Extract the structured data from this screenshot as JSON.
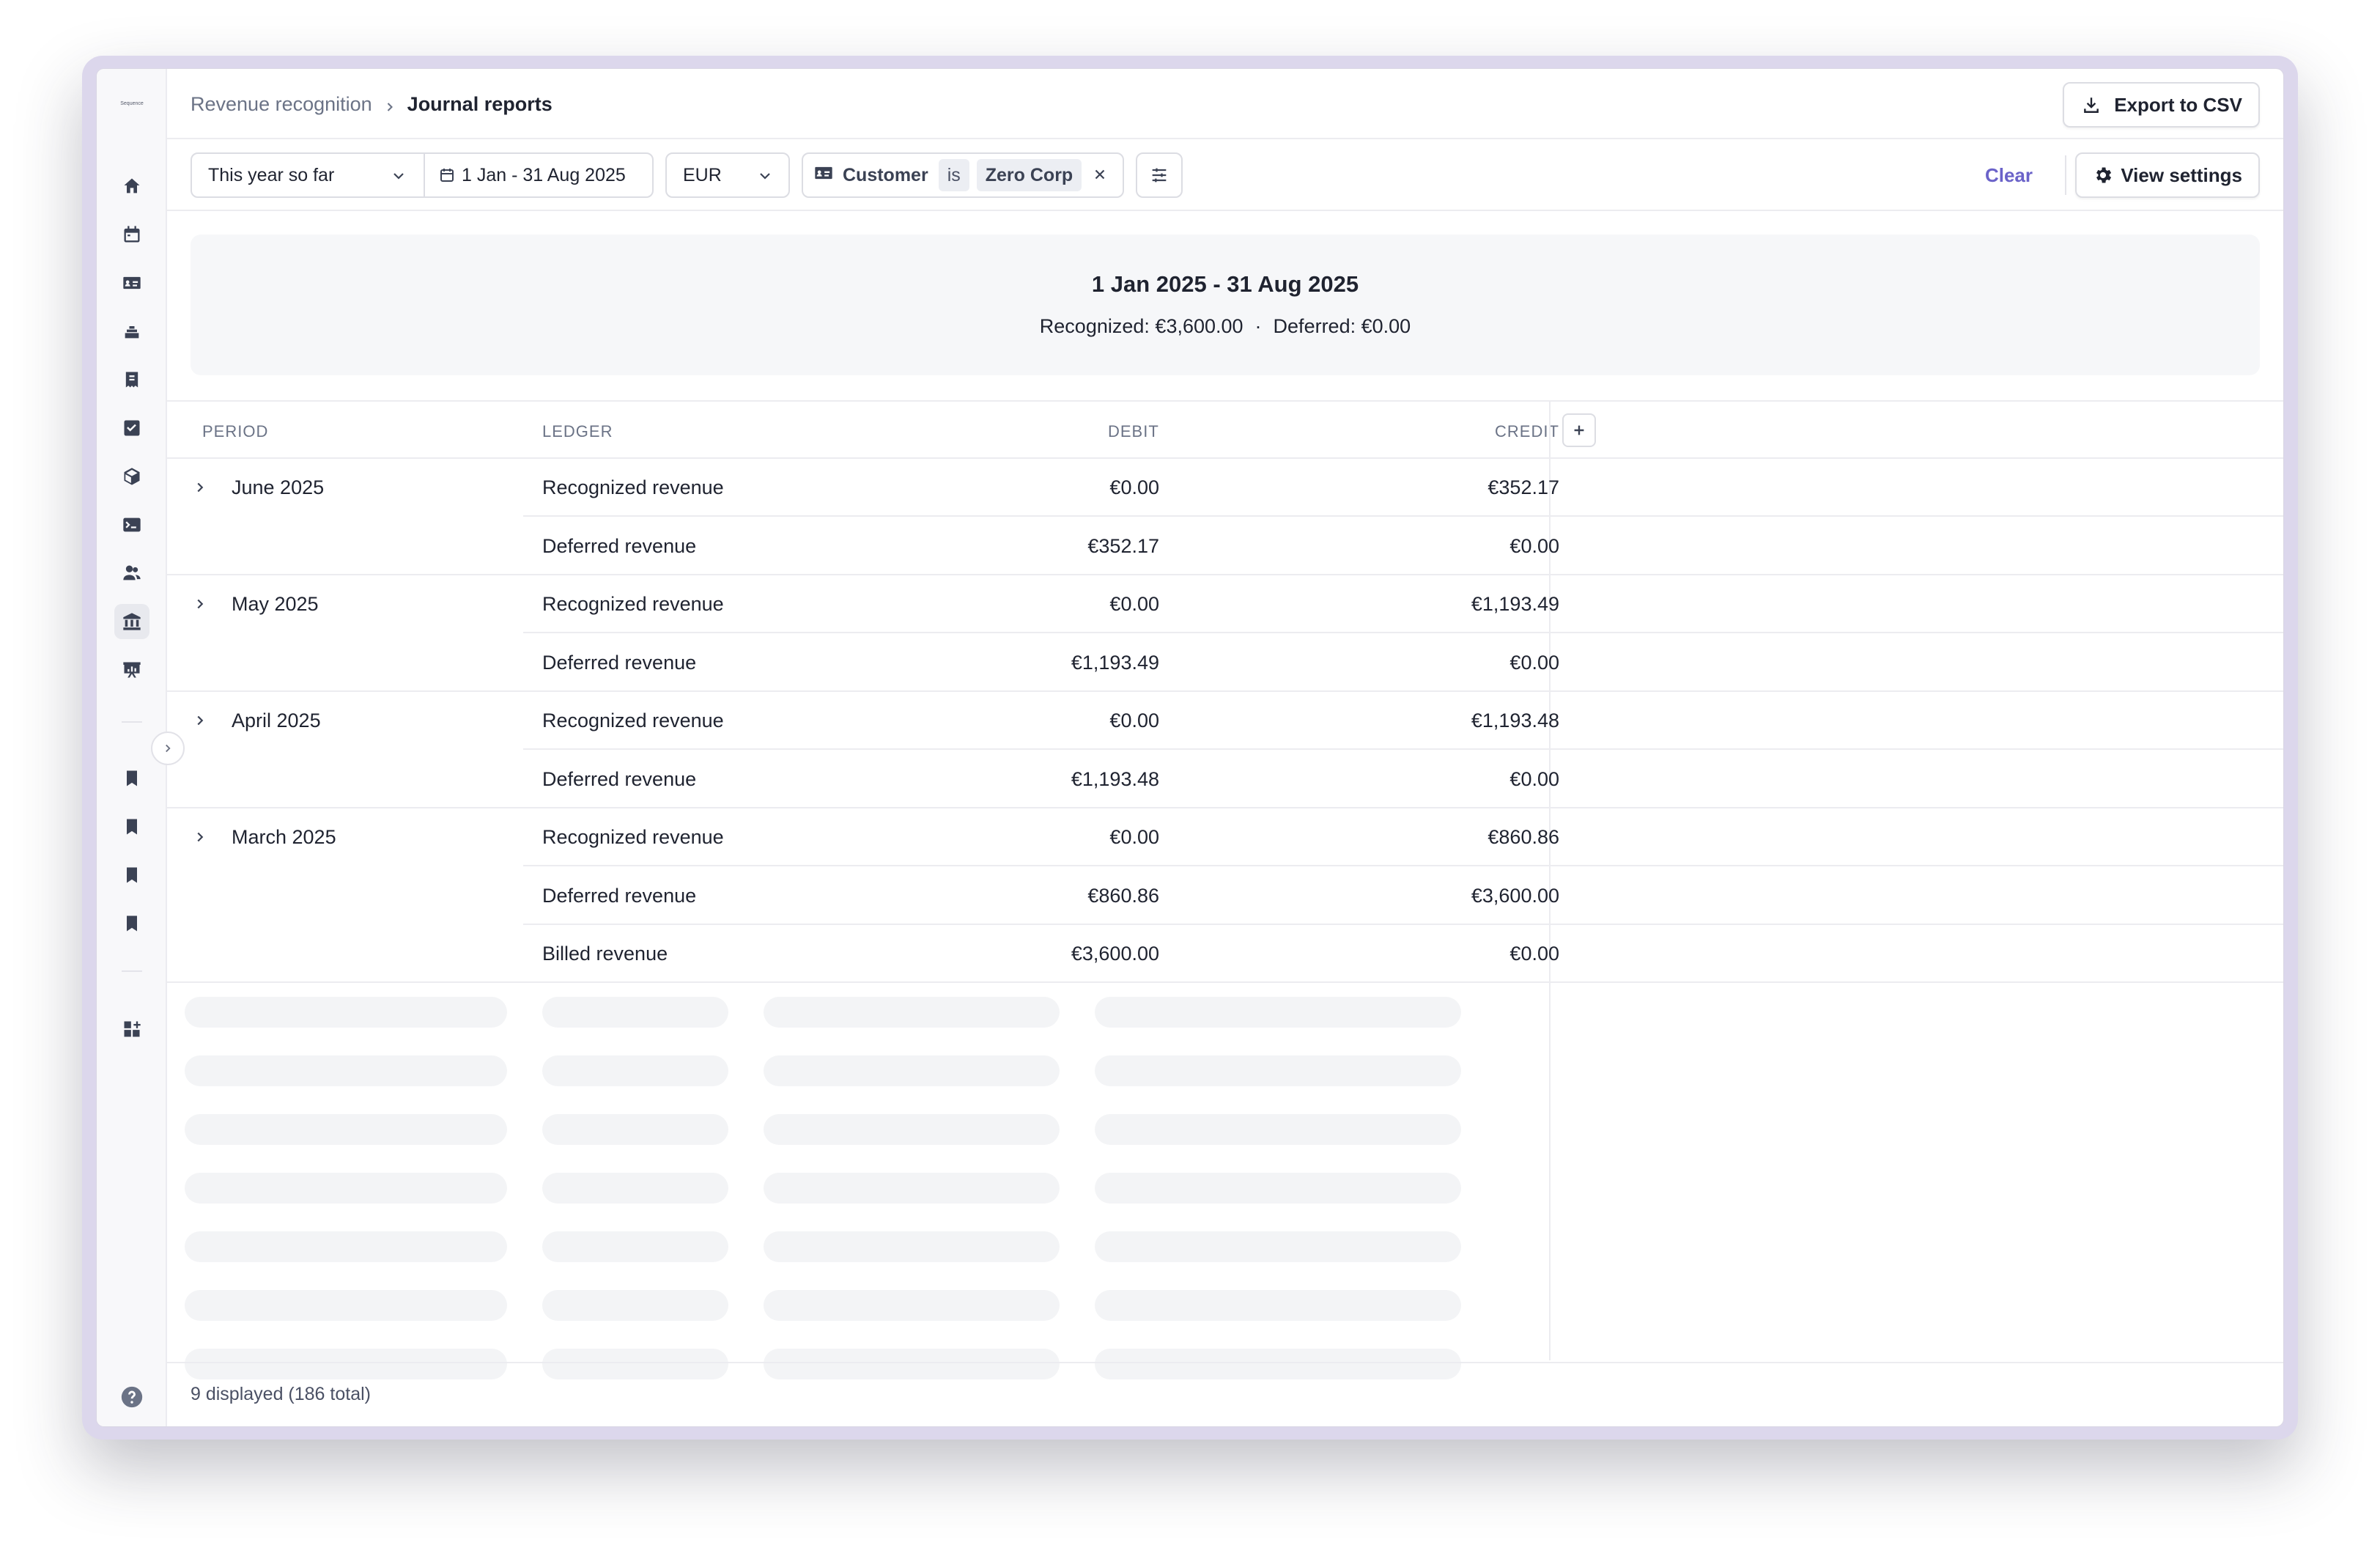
{
  "app": {
    "logo_text": "Sequence"
  },
  "breadcrumb": {
    "parent": "Revenue recognition",
    "current": "Journal reports"
  },
  "header": {
    "export_label": "Export to CSV"
  },
  "filters": {
    "period": "This year so far",
    "date_range": "1 Jan - 31 Aug 2025",
    "currency": "EUR",
    "customer_label": "Customer",
    "customer_operator": "is",
    "customer_value": "Zero Corp",
    "clear_label": "Clear",
    "view_settings_label": "View settings"
  },
  "summary": {
    "title": "1 Jan 2025 - 31 Aug 2025",
    "recognized_label": "Recognized:",
    "recognized_value": "€3,600.00",
    "separator": "·",
    "deferred_label": "Deferred:",
    "deferred_value": "€0.00"
  },
  "table": {
    "columns": {
      "period": "Period",
      "ledger": "Ledger",
      "debit": "Debit",
      "credit": "Credit"
    },
    "groups": [
      {
        "period": "June 2025",
        "rows": [
          {
            "ledger": "Recognized revenue",
            "debit": "€0.00",
            "credit": "€352.17"
          },
          {
            "ledger": "Deferred revenue",
            "debit": "€352.17",
            "credit": "€0.00"
          }
        ]
      },
      {
        "period": "May 2025",
        "rows": [
          {
            "ledger": "Recognized revenue",
            "debit": "€0.00",
            "credit": "€1,193.49"
          },
          {
            "ledger": "Deferred revenue",
            "debit": "€1,193.49",
            "credit": "€0.00"
          }
        ]
      },
      {
        "period": "April 2025",
        "rows": [
          {
            "ledger": "Recognized revenue",
            "debit": "€0.00",
            "credit": "€1,193.48"
          },
          {
            "ledger": "Deferred revenue",
            "debit": "€1,193.48",
            "credit": "€0.00"
          }
        ]
      },
      {
        "period": "March 2025",
        "rows": [
          {
            "ledger": "Recognized revenue",
            "debit": "€0.00",
            "credit": "€860.86"
          },
          {
            "ledger": "Deferred revenue",
            "debit": "€860.86",
            "credit": "€3,600.00"
          },
          {
            "ledger": "Billed revenue",
            "debit": "€3,600.00",
            "credit": "€0.00"
          }
        ]
      }
    ]
  },
  "footer": {
    "count_text": "9 displayed (186 total)"
  },
  "sidebar": {
    "items": [
      "home-icon",
      "calendar-icon",
      "id-card-icon",
      "stack-icon",
      "invoice-icon",
      "check-square-icon",
      "cube-icon",
      "terminal-icon",
      "users-icon",
      "bank-icon",
      "presentation-icon"
    ],
    "active": "bank-icon",
    "bookmarks": 4
  },
  "colors": {
    "accent": "#6b63c9",
    "text": "#1f2330",
    "muted": "#6b7386",
    "border": "#ececf0"
  }
}
